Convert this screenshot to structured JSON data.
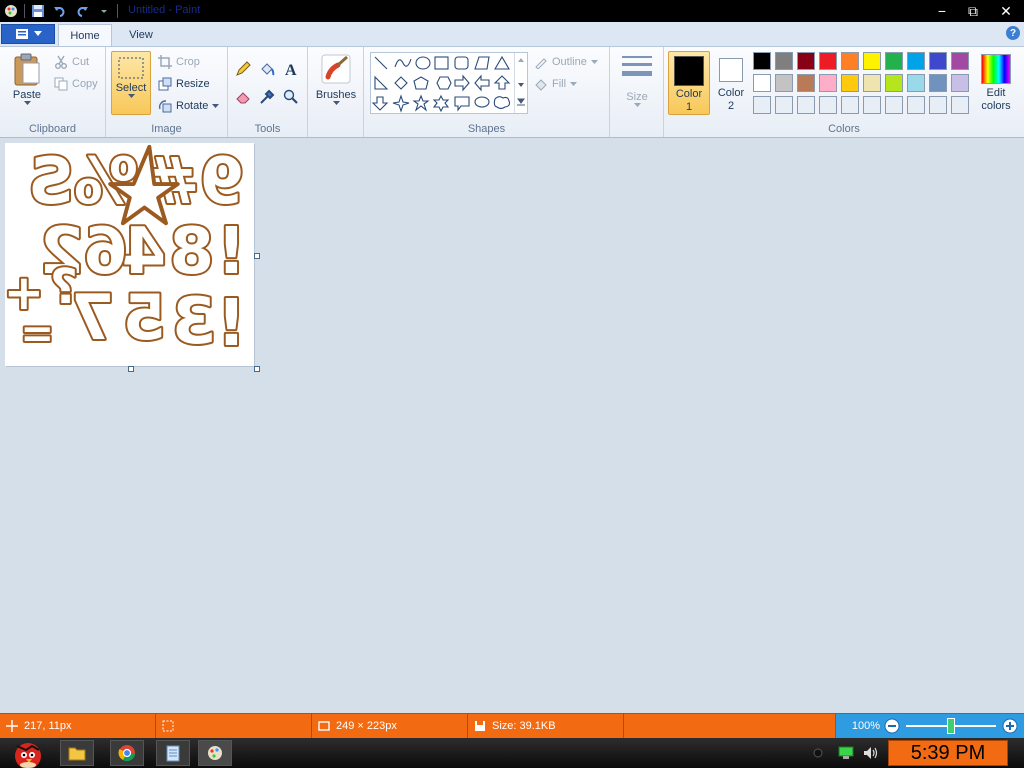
{
  "window": {
    "title": "Untitled - Paint",
    "controls": {
      "minimize": "−",
      "restore": "⧉",
      "close": "✕"
    }
  },
  "ribbon_tabs": {
    "home": "Home",
    "view": "View",
    "help": "?"
  },
  "clipboard": {
    "paste": "Paste",
    "cut": "Cut",
    "copy": "Copy",
    "label": "Clipboard"
  },
  "image": {
    "select": "Select",
    "crop": "Crop",
    "resize": "Resize",
    "rotate": "Rotate",
    "label": "Image"
  },
  "tools": {
    "label": "Tools"
  },
  "brushes": {
    "label": "Brushes"
  },
  "shapes": {
    "outline": "Outline",
    "fill": "Fill",
    "label": "Shapes"
  },
  "size": {
    "label": "Size"
  },
  "colors": {
    "color1": "Color 1",
    "color2": "Color 2",
    "edit": "Edit colors",
    "label": "Colors",
    "color1_value": "#000000",
    "color2_value": "#ffffff",
    "palette_row1": [
      "#000000",
      "#7f7f7f",
      "#880015",
      "#ed1c24",
      "#ff7f27",
      "#fff200",
      "#22b14c",
      "#00a2e8",
      "#3f48cc",
      "#a349a4"
    ],
    "palette_row2": [
      "#ffffff",
      "#c3c3c3",
      "#b97a57",
      "#ffaec9",
      "#ffc90e",
      "#efe4b0",
      "#b5e61d",
      "#99d9ea",
      "#7092be",
      "#c8bfe7"
    ],
    "palette_row3": [
      "#e8eef6",
      "#e8eef6",
      "#e8eef6",
      "#e8eef6",
      "#e8eef6",
      "#e8eef6",
      "#e8eef6",
      "#e8eef6",
      "#e8eef6",
      "#e8eef6"
    ]
  },
  "status": {
    "cursor_pos": "217, 11px",
    "image_size": "249 × 223px",
    "file_size": "Size: 39.1KB",
    "zoom": "100%",
    "zoom_level": 0.5
  },
  "taskbar": {
    "time": "5:39 PM"
  }
}
